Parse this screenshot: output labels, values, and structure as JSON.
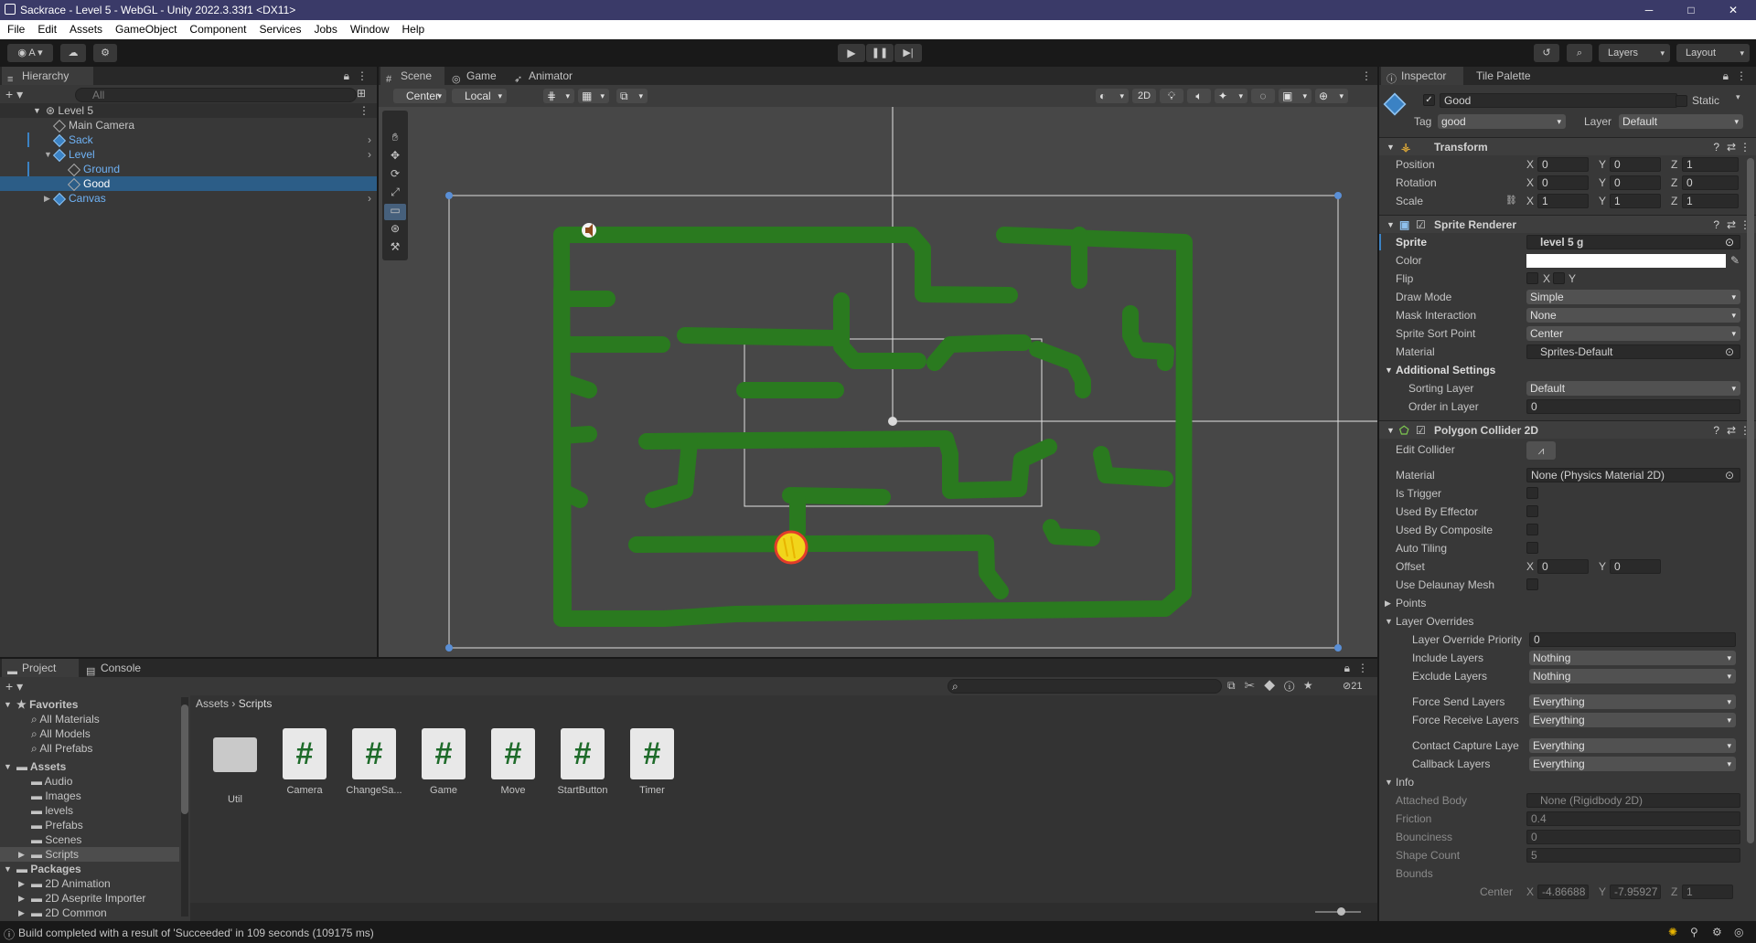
{
  "window": {
    "title": "Sackrace - Level 5 - WebGL - Unity 2022.3.33f1 <DX11>",
    "minimize": "─",
    "maximize": "□",
    "close": "✕"
  },
  "menu": [
    "File",
    "Edit",
    "Assets",
    "GameObject",
    "Component",
    "Services",
    "Jobs",
    "Window",
    "Help"
  ],
  "toolbar": {
    "account": "A",
    "layers": "Layers",
    "layout": "Layout"
  },
  "hierarchy": {
    "tab": "Hierarchy",
    "search_placeholder": "All",
    "scene": "Level 5",
    "items": [
      {
        "label": "Main Camera"
      },
      {
        "label": "Sack"
      },
      {
        "label": "Level"
      },
      {
        "label": "Ground"
      },
      {
        "label": "Good"
      },
      {
        "label": "Canvas"
      }
    ]
  },
  "scene_view": {
    "tabs": [
      "Scene",
      "Game",
      "Animator"
    ],
    "pivot": "Center",
    "space": "Local",
    "mode_2d": "2D",
    "colors": {
      "maze": "#2a7a1f",
      "background": "#474747",
      "coin": "#f1d51b"
    }
  },
  "inspector": {
    "tabs": [
      "Inspector",
      "Tile Palette"
    ],
    "object_name": "Good",
    "static_label": "Static",
    "tag_label": "Tag",
    "tag_value": "good",
    "layer_label": "Layer",
    "layer_value": "Default",
    "transform": {
      "title": "Transform",
      "position_label": "Position",
      "rotation_label": "Rotation",
      "scale_label": "Scale",
      "position": [
        "0",
        "0",
        "1"
      ],
      "rotation": [
        "0",
        "0",
        "0"
      ],
      "scale": [
        "1",
        "1",
        "1"
      ],
      "axes": [
        "X",
        "Y",
        "Z"
      ]
    },
    "sprite_renderer": {
      "title": "Sprite Renderer",
      "sprite_label": "Sprite",
      "sprite_value": "level 5 g",
      "color_label": "Color",
      "flip_label": "Flip",
      "flip_x": "X",
      "flip_y": "Y",
      "draw_mode_label": "Draw Mode",
      "draw_mode": "Simple",
      "mask_label": "Mask Interaction",
      "mask": "None",
      "sort_point_label": "Sprite Sort Point",
      "sort_point": "Center",
      "material_label": "Material",
      "material": "Sprites-Default",
      "additional_label": "Additional Settings",
      "sorting_layer_label": "Sorting Layer",
      "sorting_layer": "Default",
      "order_label": "Order in Layer",
      "order": "0"
    },
    "polygon_collider": {
      "title": "Polygon Collider 2D",
      "edit_label": "Edit Collider",
      "material_label": "Material",
      "material": "None (Physics Material 2D)",
      "is_trigger": "Is Trigger",
      "used_by_effector": "Used By Effector",
      "used_by_composite": "Used By Composite",
      "auto_tiling": "Auto Tiling",
      "offset_label": "Offset",
      "offset_x": "0",
      "offset_y": "0",
      "delaunay": "Use Delaunay Mesh",
      "points": "Points",
      "layer_overrides": "Layer Overrides",
      "override_priority_label": "Layer Override Priority",
      "override_priority": "0",
      "include_label": "Include Layers",
      "include": "Nothing",
      "exclude_label": "Exclude Layers",
      "exclude": "Nothing",
      "force_send_label": "Force Send Layers",
      "force_send": "Everything",
      "force_receive_label": "Force Receive Layers",
      "force_receive": "Everything",
      "contact_label": "Contact Capture Laye",
      "contact": "Everything",
      "callback_label": "Callback Layers",
      "callback": "Everything",
      "info": "Info",
      "attached_label": "Attached Body",
      "attached": "None (Rigidbody 2D)",
      "friction_label": "Friction",
      "friction": "0.4",
      "bounciness_label": "Bounciness",
      "bounciness": "0",
      "shape_label": "Shape Count",
      "shape": "5",
      "bounds_label": "Bounds",
      "center_label": "Center",
      "center_x": "-4.86688",
      "center_y": "-7.95927",
      "center_z": "1"
    }
  },
  "project": {
    "tabs": [
      "Project",
      "Console"
    ],
    "count": "21",
    "favorites": "Favorites",
    "fav_items": [
      "All Materials",
      "All Models",
      "All Prefabs"
    ],
    "assets": "Assets",
    "asset_folders": [
      "Audio",
      "Images",
      "levels",
      "Prefabs",
      "Scenes",
      "Scripts"
    ],
    "packages": "Packages",
    "package_items": [
      "2D Animation",
      "2D Aseprite Importer",
      "2D Common"
    ],
    "breadcrumb": [
      "Assets",
      "Scripts"
    ],
    "files": [
      {
        "name": "Util",
        "type": "folder"
      },
      {
        "name": "Camera",
        "type": "script"
      },
      {
        "name": "ChangeSa...",
        "type": "script"
      },
      {
        "name": "Game",
        "type": "script"
      },
      {
        "name": "Move",
        "type": "script"
      },
      {
        "name": "StartButton",
        "type": "script"
      },
      {
        "name": "Timer",
        "type": "script"
      }
    ]
  },
  "status": {
    "message": "Build completed with a result of 'Succeeded' in 109 seconds (109175 ms)"
  }
}
